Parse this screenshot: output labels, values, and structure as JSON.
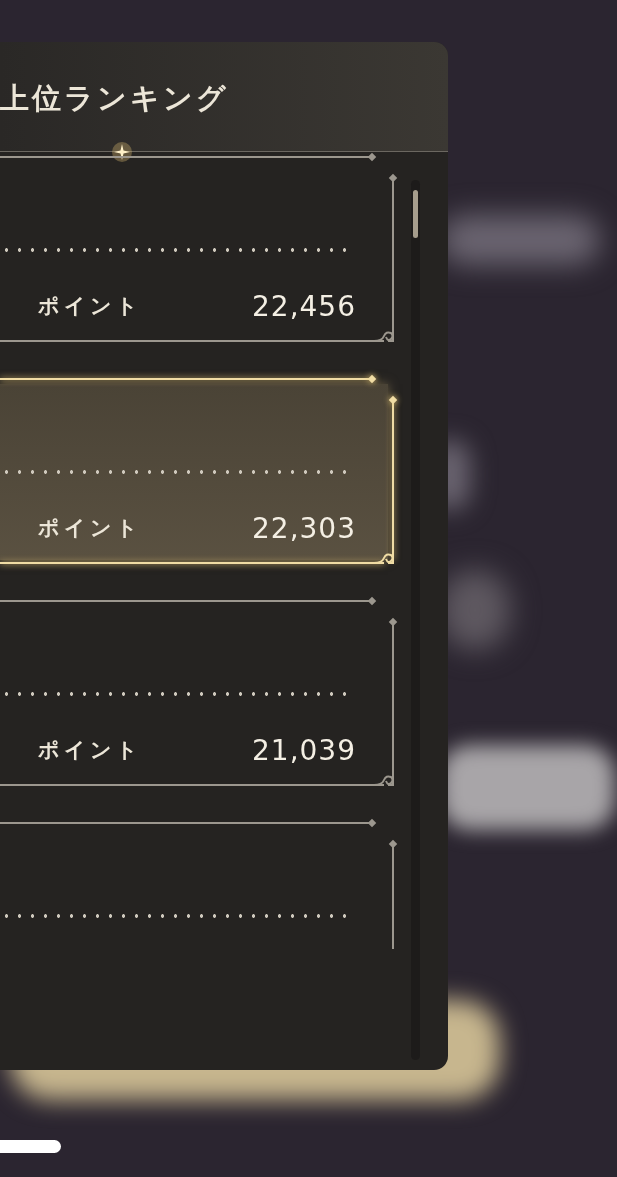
{
  "panel": {
    "title": "上位ランキング",
    "rows": [
      {
        "selected": false,
        "points_label": "ポイント",
        "points": "22,456"
      },
      {
        "selected": true,
        "points_label": "ポイント",
        "points": "22,303"
      },
      {
        "selected": false,
        "points_label": "ポイント",
        "points": "21,039"
      },
      {
        "selected": false
      }
    ]
  }
}
